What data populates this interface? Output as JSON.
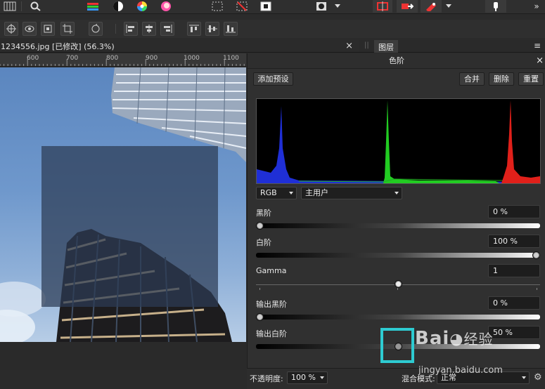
{
  "document": {
    "tab_title": "1234556.jpg [已修改] (56.3%)",
    "close_glyph": "×"
  },
  "ruler": {
    "labels": [
      "600",
      "700",
      "800",
      "900",
      "1000",
      "1100"
    ]
  },
  "panel_tabs": {
    "layers_label": "图层",
    "menu_glyph": "≡"
  },
  "levels": {
    "title": "色阶",
    "close_glyph": "×",
    "add_preset_label": "添加预设",
    "merge_label": "合并",
    "delete_label": "删除",
    "reset_label": "重置",
    "channel_select": "RGB",
    "preset_select": "主用户",
    "black_level": {
      "label": "黑阶",
      "value": "0 %",
      "fraction": 0.0
    },
    "white_level": {
      "label": "白阶",
      "value": "100 %",
      "fraction": 1.0
    },
    "gamma": {
      "label": "Gamma",
      "value": "1",
      "fraction": 0.5
    },
    "output_black": {
      "label": "输出黑阶",
      "value": "0 %",
      "fraction": 0.0
    },
    "output_white": {
      "label": "输出白阶",
      "value": "50 %",
      "fraction": 0.5
    }
  },
  "bottom": {
    "opacity_label": "不透明度:",
    "opacity_value": "100 %",
    "blend_label": "混合模式:",
    "blend_value": "正常"
  },
  "watermark": {
    "brand": "Bai",
    "brand2": "经验",
    "url": "jingyan.baidu.com"
  },
  "colors": {
    "highlight": "#2ecbd1",
    "hist_red": "#e0201a",
    "hist_green": "#22cc22",
    "hist_blue": "#1f2fd6"
  },
  "icons": {
    "toolbar1": [
      "liquify-persona-icon",
      "zoom-icon",
      "levels-icon",
      "contrast-icon",
      "color-wheel-icon",
      "hsl-icon",
      "marquee-select-icon",
      "deselect-icon",
      "invert-selection-icon",
      "mask-icon",
      "snapping-icon",
      "export-icon",
      "pen-icon",
      "assistant-icon",
      "more-icon"
    ],
    "toolbar2": [
      "move-icon",
      "view-icon",
      "transform-icon",
      "crop-icon",
      "rotate-icon",
      "align-left-icon",
      "align-center-icon",
      "align-right-icon",
      "align-top-icon",
      "align-middle-icon",
      "align-bottom-icon"
    ]
  }
}
